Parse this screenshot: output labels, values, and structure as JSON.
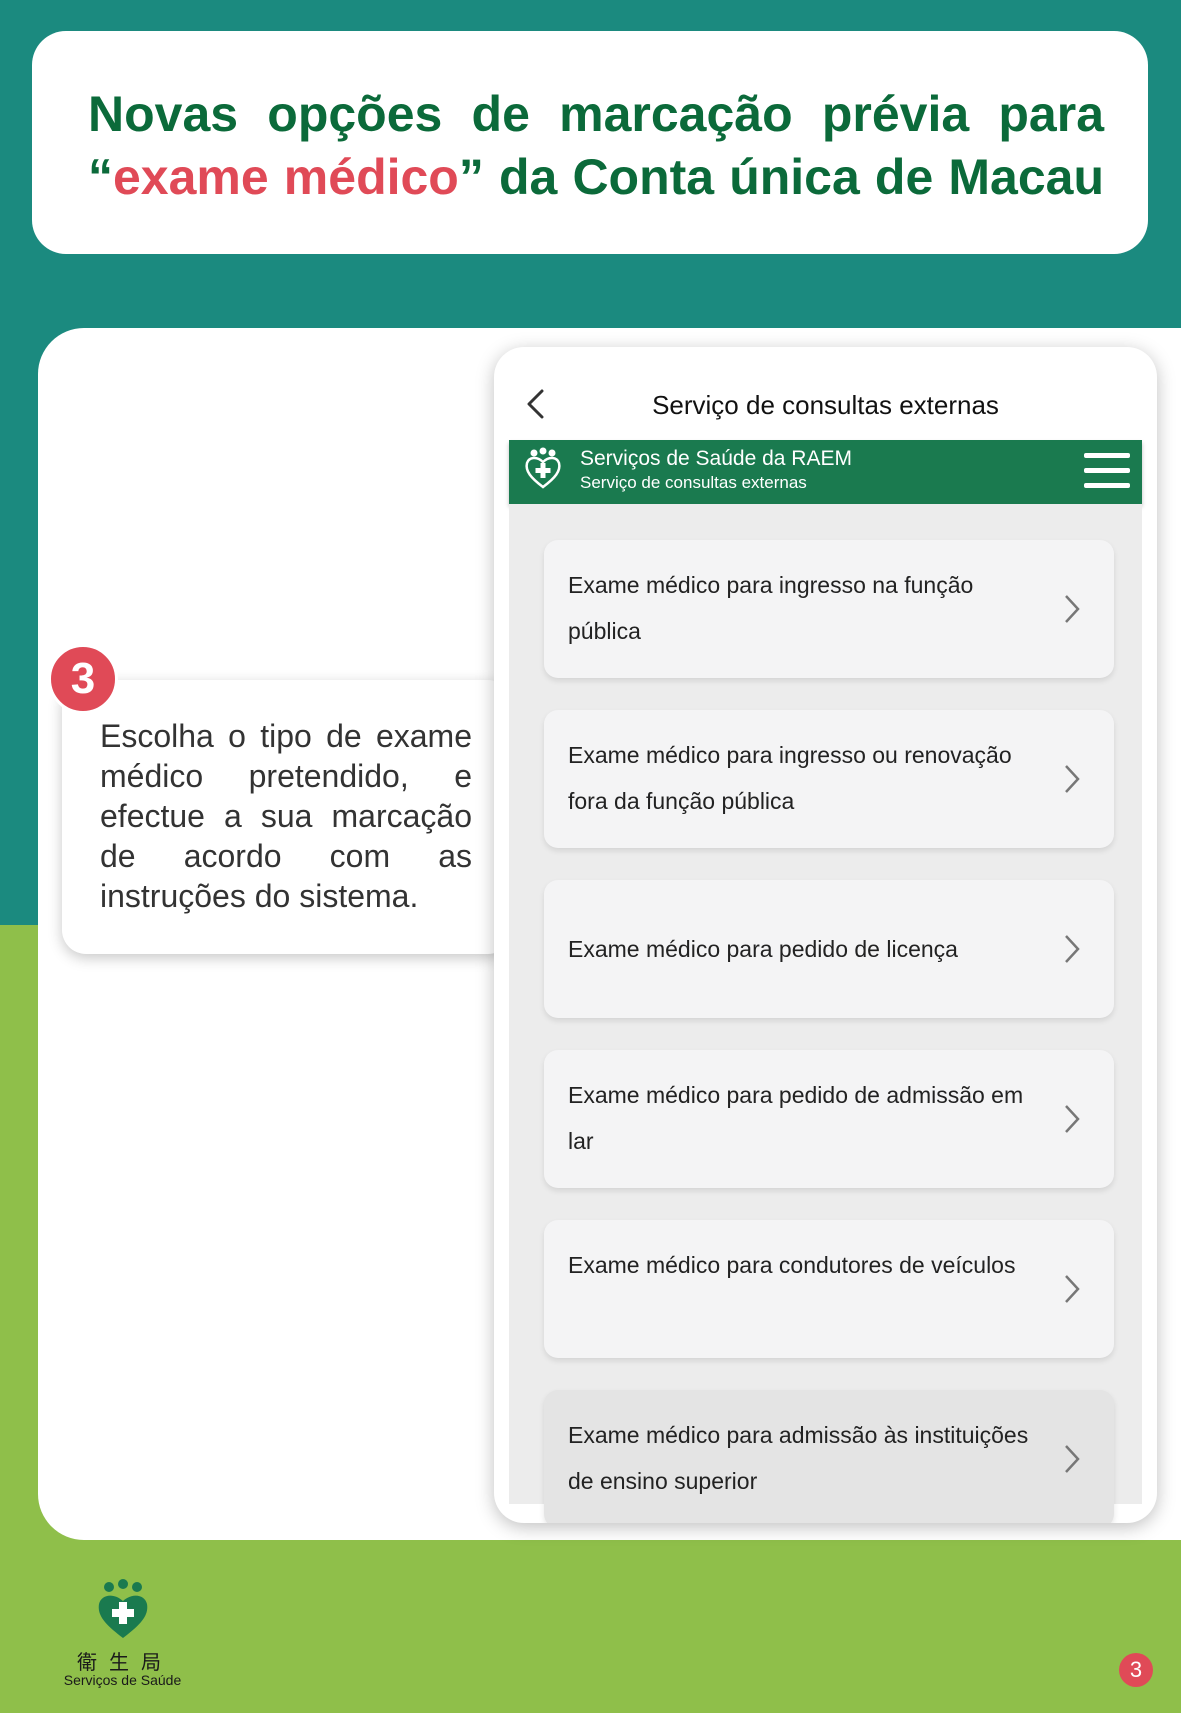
{
  "header": {
    "title_part1": "Novas opções de marcação prévia para “",
    "title_highlight": "exame médico",
    "title_part2": "” da Conta única de Macau"
  },
  "step": {
    "number": "3",
    "text": "Escolha o tipo de exame médico pretendido, e efectue a sua marcação de acordo com as instruções do sistema."
  },
  "phone": {
    "page_title": "Serviço de consultas externas",
    "app_bar": {
      "title": "Serviços de Saúde da RAEM",
      "subtitle": "Serviço de consultas externas"
    },
    "options": [
      {
        "label": "Exame médico para ingresso na função pública",
        "selected": false
      },
      {
        "label": "Exame médico para ingresso ou renovação fora da função pública",
        "selected": false
      },
      {
        "label": "Exame médico para pedido de licença",
        "selected": false
      },
      {
        "label": "Exame médico para pedido de admissão em lar",
        "selected": false
      },
      {
        "label": "Exame médico para condutores de veículos",
        "selected": false
      },
      {
        "label": "Exame médico para admissão às instituições de ensino superior",
        "selected": true
      }
    ]
  },
  "footer": {
    "org_chinese": "衛生局",
    "org_name": "Serviços de Saúde",
    "page_number": "3"
  },
  "colors": {
    "teal": "#1b8a7f",
    "green": "#8fbf4a",
    "title_green": "#0b6a3a",
    "accent_red": "#e04a57",
    "app_bar": "#1a7a4f"
  }
}
